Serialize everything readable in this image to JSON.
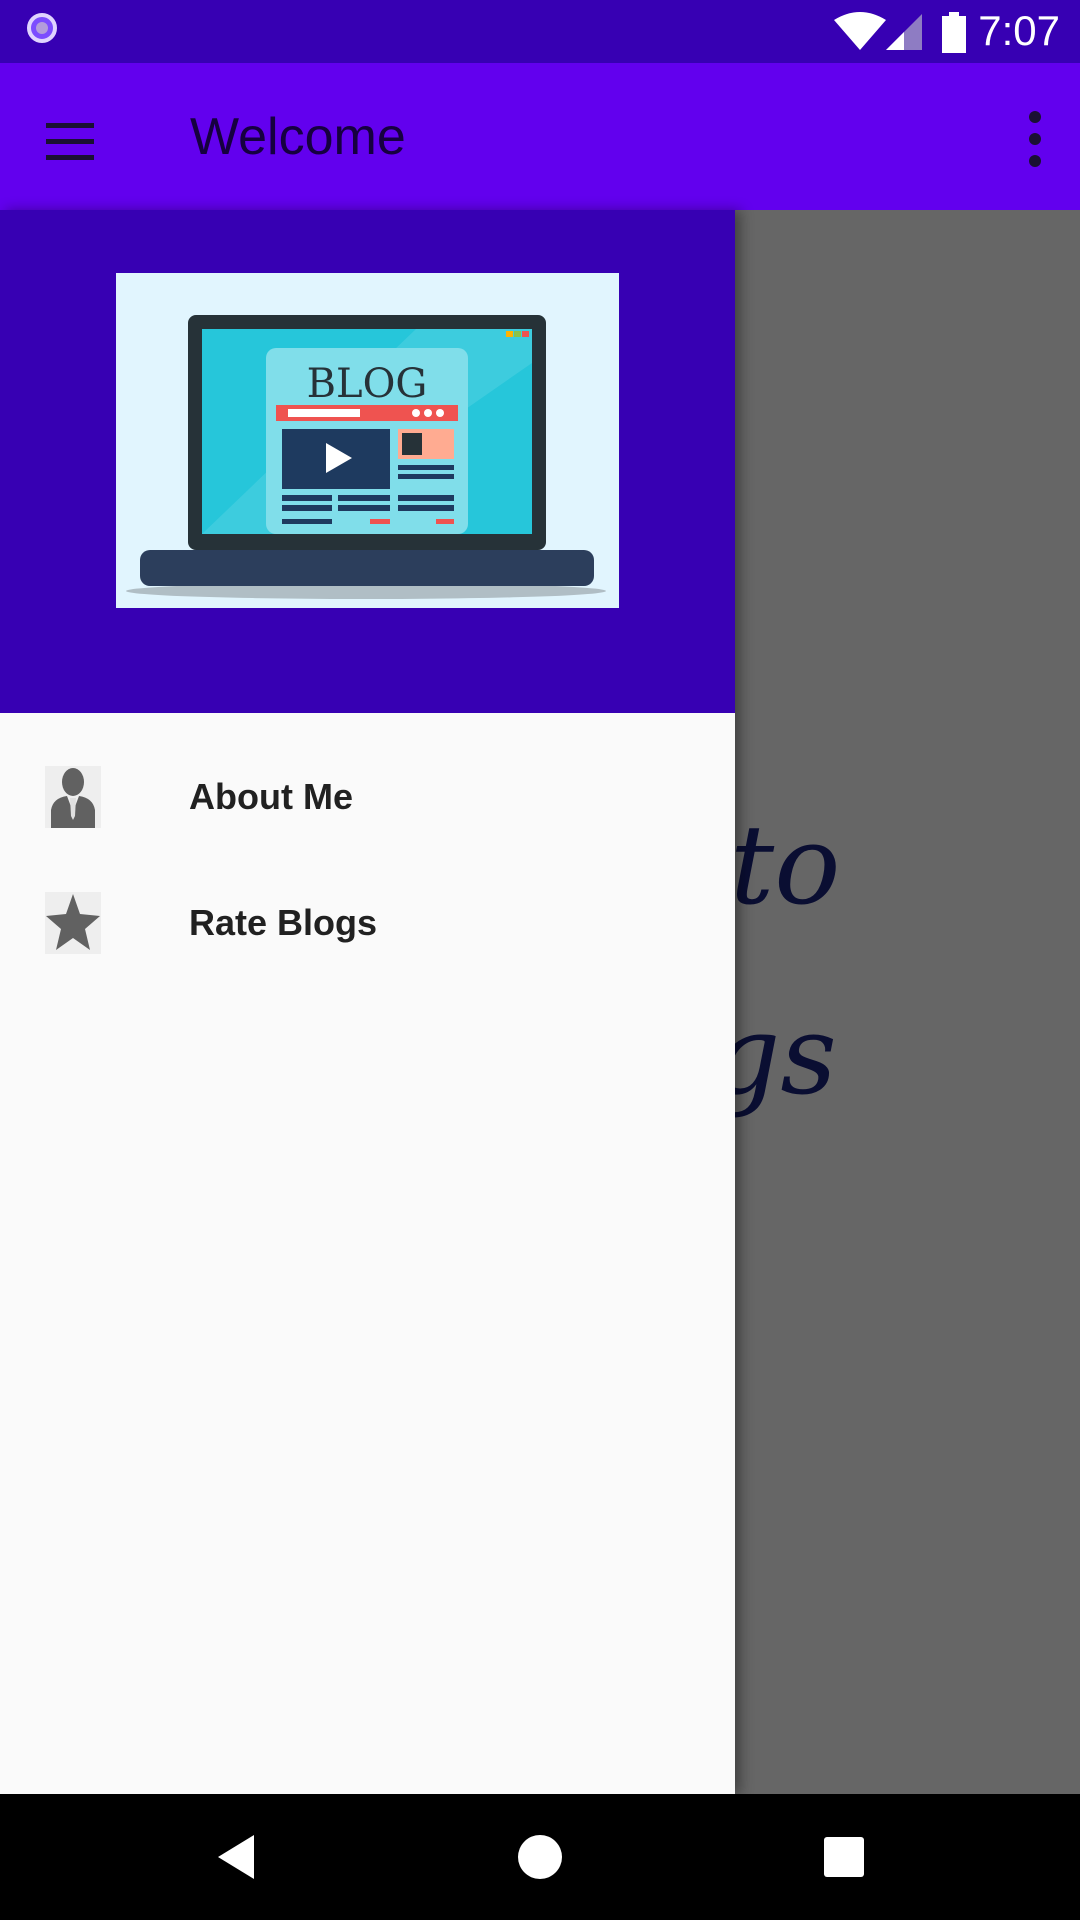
{
  "status_bar": {
    "time": "7:07"
  },
  "app_bar": {
    "title": "Welcome"
  },
  "main": {
    "background_text_line1": "to",
    "background_text_line2": "gs"
  },
  "drawer": {
    "header_image": {
      "text": "BLOG"
    },
    "items": [
      {
        "label": "About Me",
        "icon": "businessman-icon"
      },
      {
        "label": "Rate Blogs",
        "icon": "star-icon"
      }
    ]
  },
  "colors": {
    "primary": "#6200ee",
    "primary_dark": "#3700b3",
    "drawer_bg": "#fafafa"
  }
}
